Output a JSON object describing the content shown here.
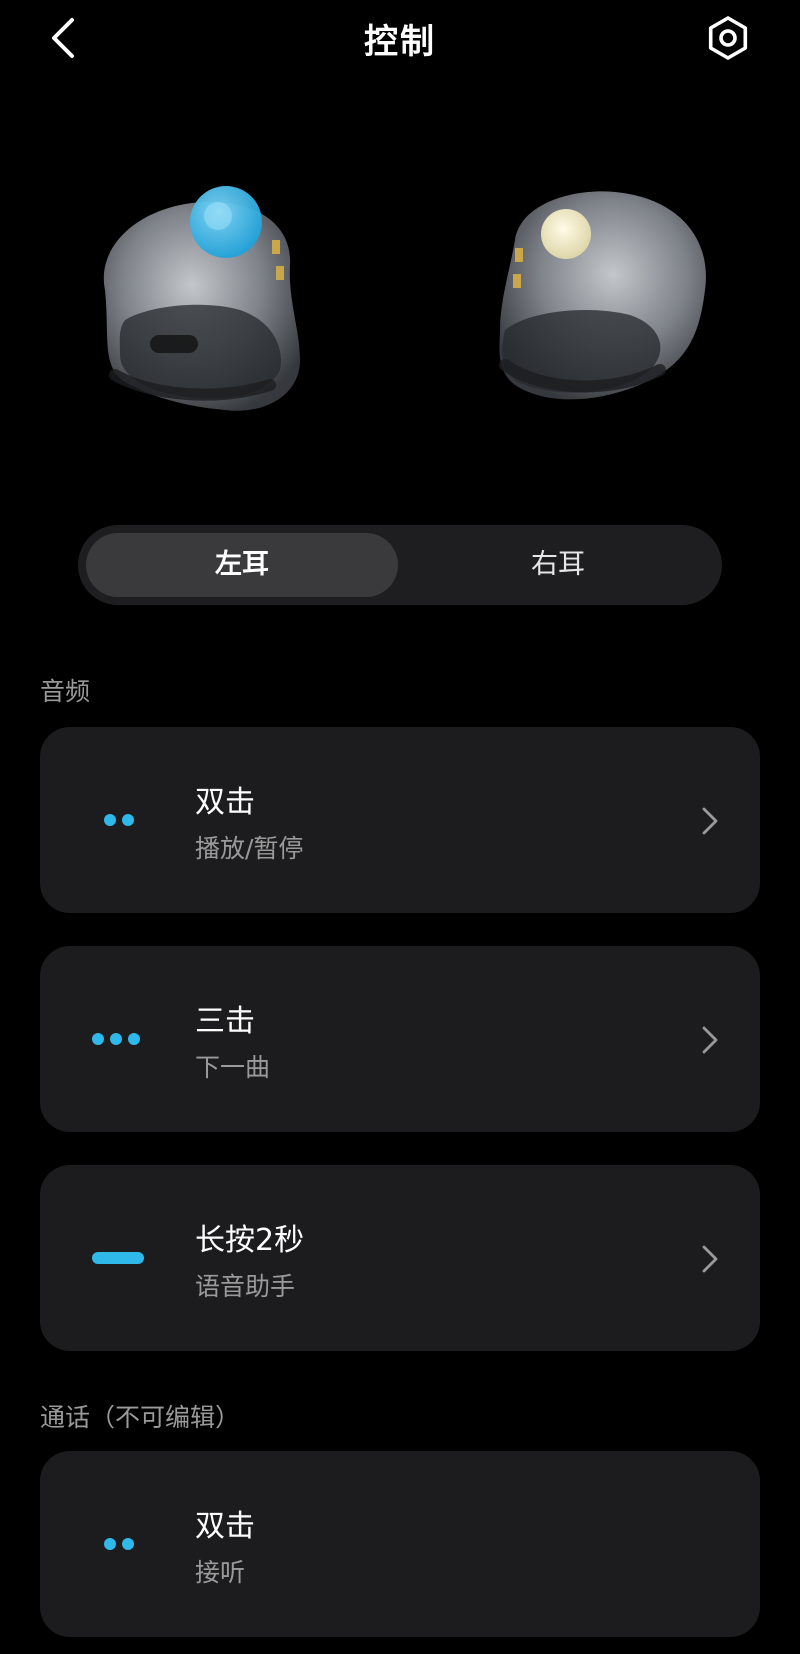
{
  "header": {
    "title": "控制"
  },
  "tabs": [
    {
      "label": "左耳",
      "selected": true
    },
    {
      "label": "右耳",
      "selected": false
    }
  ],
  "audio_section": {
    "title": "音频",
    "items": [
      {
        "gesture": "双击",
        "action": "播放/暂停",
        "gesture_icon": "double-tap-dots-icon"
      },
      {
        "gesture": "三击",
        "action": "下一曲",
        "gesture_icon": "triple-tap-dots-icon"
      },
      {
        "gesture": "长按2秒",
        "action": "语音助手",
        "gesture_icon": "long-press-bar-icon"
      }
    ]
  },
  "call_section": {
    "title": "通话（不可编辑）",
    "items": [
      {
        "gesture": "双击",
        "action": "接听",
        "gesture_icon": "double-tap-dots-icon"
      }
    ]
  },
  "colors": {
    "background": "#000000",
    "card": "#1c1c1e",
    "accent": "#2fb8ea",
    "muted_text": "#9a9a9a"
  }
}
